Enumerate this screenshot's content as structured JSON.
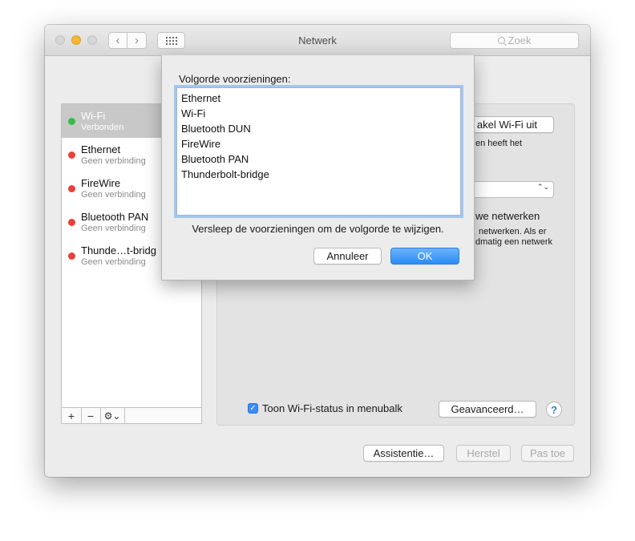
{
  "window": {
    "title": "Netwerk"
  },
  "search": {
    "placeholder": "Zoek"
  },
  "sidebar": {
    "services": [
      {
        "name": "Wi-Fi",
        "status": "Verbonden",
        "color": "#2fbf4a"
      },
      {
        "name": "Ethernet",
        "status": "Geen verbinding",
        "color": "#e8403a"
      },
      {
        "name": "FireWire",
        "status": "Geen verbinding",
        "color": "#e8403a"
      },
      {
        "name": "Bluetooth PAN",
        "status": "Geen verbinding",
        "color": "#e8403a"
      },
      {
        "name": "Thunde…t-bridg",
        "status": "Geen verbinding",
        "color": "#e8403a"
      }
    ],
    "toolbar": {
      "add": "+",
      "remove": "−",
      "action": "⚙⌄"
    }
  },
  "content": {
    "wifi_toggle_fragment": "akel Wi-Fi uit",
    "status_fragment": "en heeft het",
    "network_popup_arrows": "⌃⌄",
    "ask_fragment": "we netwerken",
    "ask_desc_line1": "netwerken. Als er",
    "ask_desc_line2": "dmatig een netwerk",
    "show_status_label": "Toon Wi-Fi-status in menubalk",
    "show_status_checked": true,
    "advanced_button": "Geavanceerd…",
    "help": "?"
  },
  "footer": {
    "assist_button": "Assistentie…",
    "revert_button": "Herstel",
    "apply_button": "Pas toe"
  },
  "sheet": {
    "label": "Volgorde voorzieningen:",
    "items": [
      "Ethernet",
      "Wi-Fi",
      "Bluetooth DUN",
      "FireWire",
      "Bluetooth PAN",
      "Thunderbolt-bridge"
    ],
    "hint": "Versleep de voorzieningen om de volgorde te wijzigen.",
    "cancel_button": "Annuleer",
    "ok_button": "OK"
  }
}
